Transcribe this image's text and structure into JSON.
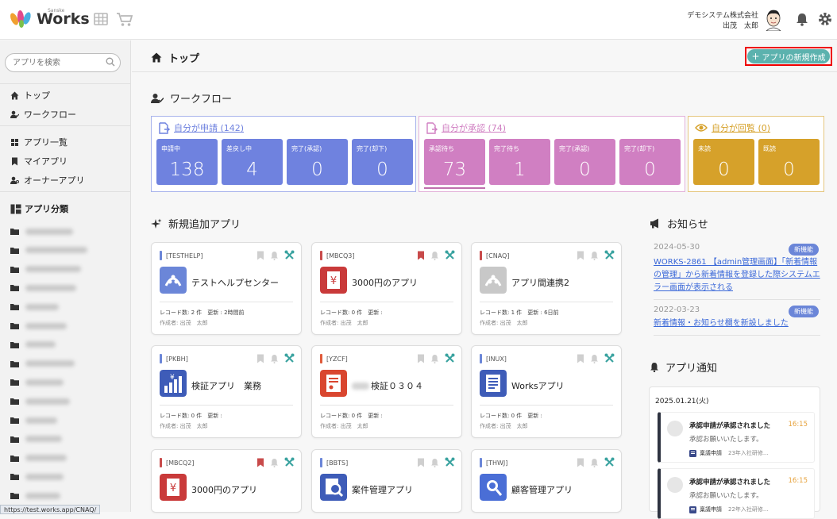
{
  "header": {
    "logo_small": "Sanske",
    "logo_text": "Works",
    "company": "デモシステム株式会社",
    "user": "出茂　太郎"
  },
  "sidebar": {
    "search_placeholder": "アプリを検索",
    "nav": [
      {
        "label": "トップ",
        "icon": "home-icon"
      },
      {
        "label": "ワークフロー",
        "icon": "user-check-icon"
      },
      {
        "label": "アプリ一覧",
        "icon": "grid-icon"
      },
      {
        "label": "マイアプリ",
        "icon": "bookmark-icon"
      },
      {
        "label": "オーナーアプリ",
        "icon": "user-key-icon"
      }
    ],
    "category_title": "アプリ分類",
    "folder_count": 15
  },
  "status_url": "https://test.works.app/CNAQ/",
  "page": {
    "title": "トップ",
    "new_app_button": "アプリの新規作成"
  },
  "workflow": {
    "title": "ワークフロー",
    "groups": [
      {
        "header": "自分が申請 (142)",
        "color": "#6f82df",
        "tiles": [
          {
            "label": "申請中",
            "value": "138"
          },
          {
            "label": "差戻し中",
            "value": "4"
          },
          {
            "label": "完了(承認)",
            "value": "0"
          },
          {
            "label": "完了(却下)",
            "value": "0"
          }
        ]
      },
      {
        "header": "自分が承認 (74)",
        "color": "#d07fc2",
        "tiles": [
          {
            "label": "承認待ち",
            "value": "73"
          },
          {
            "label": "完了待ち",
            "value": "1"
          },
          {
            "label": "完了(承認)",
            "value": "0"
          },
          {
            "label": "完了(却下)",
            "value": "0"
          }
        ]
      },
      {
        "header": "自分が回覧 (0)",
        "color": "#d6a12a",
        "tiles": [
          {
            "label": "未読",
            "value": "0"
          },
          {
            "label": "既読",
            "value": "0"
          }
        ]
      }
    ]
  },
  "new_apps": {
    "title": "新規追加アプリ",
    "cards": [
      {
        "code": "[TESTHELP]",
        "name": "テストヘルプセンター",
        "records": "レコード数: 2 件",
        "updated": "更新 : 2時間前",
        "creator": "作成者: 出茂　太郎",
        "bookmarked": false,
        "bar_color": "#6b86d8",
        "icon": "help-app-icon"
      },
      {
        "code": "[MBCQ3]",
        "name": "3000円のアプリ",
        "records": "レコード数: 0 件",
        "updated": "更新 :",
        "creator": "作成者: 出茂　太郎",
        "bookmarked": true,
        "bar_color": "#c84a4a",
        "icon": "yen-doc-icon"
      },
      {
        "code": "[CNAQ]",
        "name": "アプリ間連携2",
        "records": "レコード数: 1 件",
        "updated": "更新 : 6日前",
        "creator": "作成者: 出茂　太郎",
        "bookmarked": false,
        "bar_color": "#c84a4a",
        "icon": "link-app-icon"
      },
      {
        "code": "[PKBH]",
        "name": "検証アプリ　業務",
        "records": "レコード数: 0 件",
        "updated": "更新 :",
        "creator": "作成者: 出茂　太郎",
        "bookmarked": false,
        "bar_color": "#6b86d8",
        "icon": "yen-chart-icon"
      },
      {
        "code": "[YZCF]",
        "name": "検証０３０４",
        "records": "レコード数: 0 件",
        "updated": "更新 :",
        "creator": "作成者: 出茂　太郎",
        "bookmarked": false,
        "bar_color": "#e05a3a",
        "icon": "receipt-icon"
      },
      {
        "code": "[INUX]",
        "name": "Worksアプリ",
        "records": "レコード数: 0 件",
        "updated": "更新 :",
        "creator": "作成者: 出茂　太郎",
        "bookmarked": false,
        "bar_color": "#6b86d8",
        "icon": "calendar-doc-icon"
      },
      {
        "code": "[MBCQ2]",
        "name": "3000円のアプリ",
        "records": "",
        "updated": "",
        "creator": "",
        "bookmarked": true,
        "bar_color": "#c84a4a",
        "icon": "yen-doc-icon"
      },
      {
        "code": "[BBTS]",
        "name": "案件管理アプリ",
        "records": "",
        "updated": "",
        "creator": "",
        "bookmarked": false,
        "bar_color": "#6b86d8",
        "icon": "search-doc-icon"
      },
      {
        "code": "[THWJ]",
        "name": "顧客管理アプリ",
        "records": "",
        "updated": "",
        "creator": "",
        "bookmarked": false,
        "bar_color": "#6b86d8",
        "icon": "customer-icon"
      }
    ]
  },
  "news": {
    "title": "お知らせ",
    "items": [
      {
        "date": "2024-05-30",
        "badge": "新機能",
        "text": "WORKS-2861 【admin管理画面】「新着情報の管理」から新着情報を登録した際システムエラー画面が表示される"
      },
      {
        "date": "2022-03-23",
        "badge": "新機能",
        "text": "新着情報・お知らせ欄を新設しました"
      }
    ]
  },
  "notifications": {
    "title": "アプリ通知",
    "date": "2025.01.21(火)",
    "items": [
      {
        "title": "承認申請が承認されました",
        "time": "16:15",
        "body": "承認お願いいたします。",
        "app": "稟議申請",
        "sub": "23年入社研修…"
      },
      {
        "title": "承認申請が承認されました",
        "time": "16:15",
        "body": "承認お願いいたします。",
        "app": "稟議申請",
        "sub": "22年入社研修…"
      }
    ]
  }
}
